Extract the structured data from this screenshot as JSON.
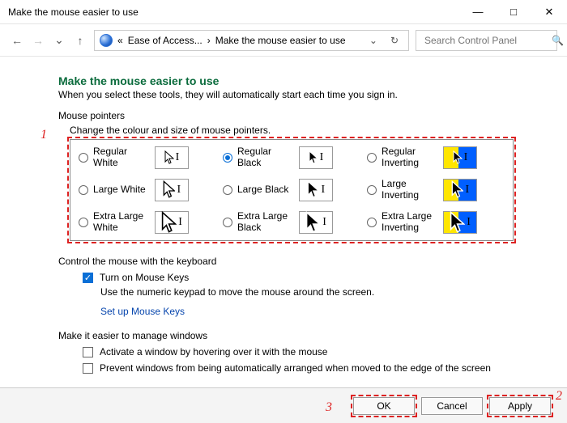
{
  "window": {
    "title": "Make the mouse easier to use"
  },
  "address": {
    "prefix": "«",
    "crumb1": "Ease of Access...",
    "sep": "›",
    "crumb2": "Make the mouse easier to use"
  },
  "search": {
    "placeholder": "Search Control Panel"
  },
  "heading": "Make the mouse easier to use",
  "subtitle": "When you select these tools, they will automatically start each time you sign in.",
  "pointers_section": "Mouse pointers",
  "pointers_subtitle": "Change the colour and size of mouse pointers.",
  "options": [
    {
      "label": "Regular White",
      "checked": false,
      "style": "white",
      "size": "s"
    },
    {
      "label": "Regular Black",
      "checked": true,
      "style": "black",
      "size": "s"
    },
    {
      "label": "Regular Inverting",
      "checked": false,
      "style": "inv",
      "size": "s"
    },
    {
      "label": "Large White",
      "checked": false,
      "style": "white",
      "size": "m"
    },
    {
      "label": "Large Black",
      "checked": false,
      "style": "black",
      "size": "m"
    },
    {
      "label": "Large Inverting",
      "checked": false,
      "style": "inv",
      "size": "m"
    },
    {
      "label": "Extra Large White",
      "checked": false,
      "style": "white",
      "size": "l"
    },
    {
      "label": "Extra Large Black",
      "checked": false,
      "style": "black",
      "size": "l"
    },
    {
      "label": "Extra Large Inverting",
      "checked": false,
      "style": "inv",
      "size": "l"
    }
  ],
  "keyboard_section": "Control the mouse with the keyboard",
  "mousekeys": {
    "label": "Turn on Mouse Keys",
    "checked": true,
    "desc": "Use the numeric keypad to move the mouse around the screen.",
    "link": "Set up Mouse Keys"
  },
  "windows_section": "Make it easier to manage windows",
  "hover": {
    "label": "Activate a window by hovering over it with the mouse",
    "checked": false
  },
  "prevent": {
    "label": "Prevent windows from being automatically arranged when moved to the edge of the screen",
    "checked": false
  },
  "buttons": {
    "ok": "OK",
    "cancel": "Cancel",
    "apply": "Apply"
  },
  "annotations": {
    "a1": "1",
    "a2": "2",
    "a3": "3"
  }
}
